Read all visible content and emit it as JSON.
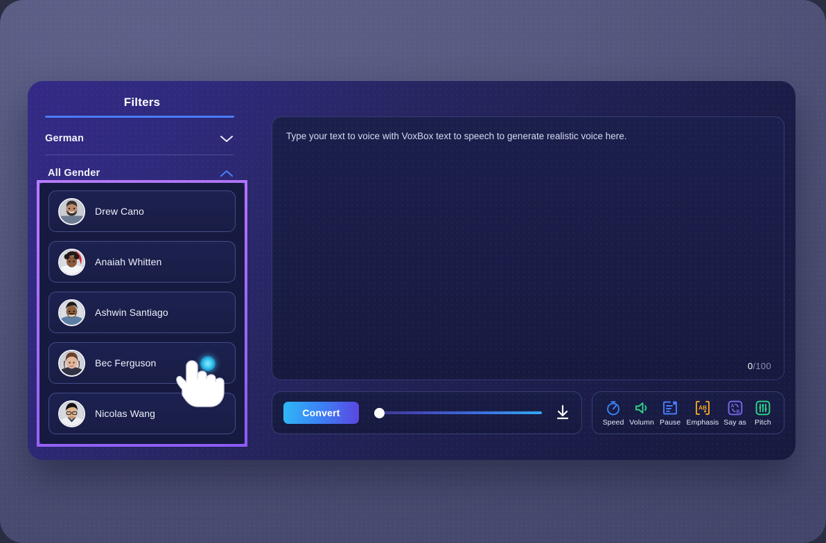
{
  "theme": {
    "backdrop": "#4f5277",
    "window_gradient_start": "#342a86",
    "window_gradient_end": "#171a3e",
    "accent_blue": "#4a7dfb",
    "highlight_purple": "#ab6ffb",
    "panel_navy": "#191d47"
  },
  "sidebar": {
    "title": "Filters",
    "filters": [
      {
        "label": "German",
        "icon": "chevron-down-icon",
        "expanded": false
      },
      {
        "label": "All Gender",
        "icon": "chevron-up-icon",
        "expanded": true
      }
    ],
    "voices": [
      {
        "name": "Drew Cano",
        "avatar": "avatar-drew-cano",
        "selected": false
      },
      {
        "name": "Anaiah Whitten",
        "avatar": "avatar-anaiah-whitten",
        "selected": false
      },
      {
        "name": "Ashwin Santiago",
        "avatar": "avatar-ashwin-santiago",
        "selected": false
      },
      {
        "name": "Bec Ferguson",
        "avatar": "avatar-bec-ferguson",
        "selected": true
      },
      {
        "name": "Nicolas Wang",
        "avatar": "avatar-nicolas-wang",
        "selected": false
      }
    ]
  },
  "editor": {
    "placeholder": "Type your text to voice with VoxBox text to speech to generate realistic voice here.",
    "value": "",
    "char_count": "0",
    "char_max": "/100"
  },
  "convert_bar": {
    "convert_label": "Convert",
    "slider_value": 0,
    "slider_min": 0,
    "slider_max": 100,
    "download_icon": "download-icon"
  },
  "effects": [
    {
      "label": "Speed",
      "icon": "stopwatch-icon",
      "color": "#3b82f6"
    },
    {
      "label": "Volumn",
      "icon": "speaker-icon",
      "color": "#2fd68a"
    },
    {
      "label": "Pause",
      "icon": "pause-text-icon",
      "color": "#4a7dfb"
    },
    {
      "label": "Emphasis",
      "icon": "emphasis-ab-icon",
      "color": "#f5a623"
    },
    {
      "label": "Say as",
      "icon": "say-as-icon",
      "color": "#7b68ee"
    },
    {
      "label": "Pitch",
      "icon": "pitch-sliders-icon",
      "color": "#2fd68a"
    }
  ],
  "cursor": {
    "type": "pointing-hand-cursor",
    "target": "Bec Ferguson"
  }
}
